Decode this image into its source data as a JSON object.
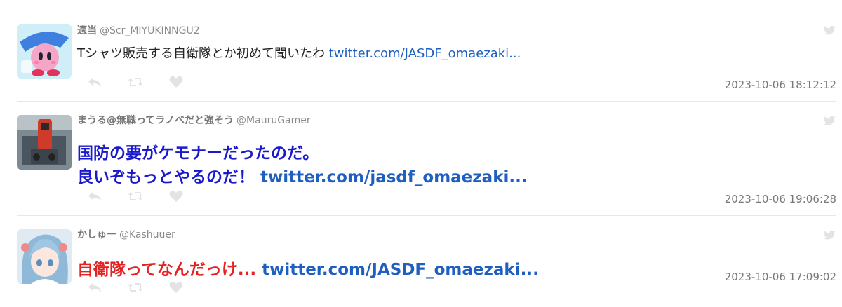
{
  "tweets": [
    {
      "display_name": "適当",
      "handle": "@Scr_MIYUKINNGU2",
      "text": "Tシャツ販売する自衛隊とか初めて聞いたわ ",
      "link": "twitter.com/JASDF_omaezaki...",
      "timestamp": "2023-10-06 18:12:12"
    },
    {
      "display_name": "まうる@無職ってラノベだと強そう",
      "handle": "@MauruGamer",
      "text_line1": "国防の要がケモナーだったのだ。",
      "text_line2": "良いぞもっとやるのだ！ ",
      "link": "twitter.com/jasdf_omaezaki...",
      "timestamp": "2023-10-06 19:06:28"
    },
    {
      "display_name": "かしゅー",
      "handle": "@Kashuuer",
      "text": "自衛隊ってなんだっけ... ",
      "link": "twitter.com/JASDF_omaezaki...",
      "timestamp": "2023-10-06 17:09:02"
    }
  ],
  "icons": {
    "reply": "reply-icon",
    "retweet": "retweet-icon",
    "like": "heart-icon",
    "source": "twitter-bird-icon"
  },
  "colors": {
    "link": "#1f5fc0",
    "body2": "#1a1acc",
    "body3": "#e52222",
    "icon": "#e3e3e3"
  }
}
